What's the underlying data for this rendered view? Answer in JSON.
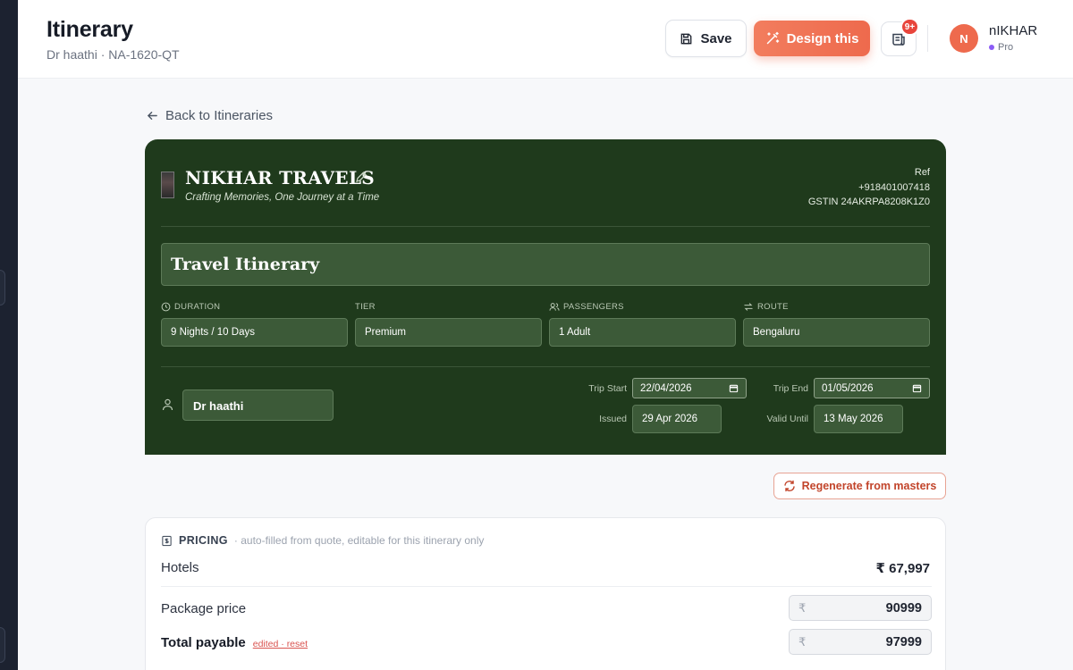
{
  "header": {
    "title": "Itinerary",
    "subtitle": "Dr haathi · NA-1620-QT",
    "save_label": "Save",
    "design_label": "Design this",
    "notif_count": "9+",
    "user": {
      "initial": "N",
      "name": "nIKHAR",
      "plan": "Pro"
    }
  },
  "nav": {
    "back_label": "Back to Itineraries"
  },
  "card": {
    "company": "NIKHAR TRAVELS",
    "tagline": "Crafting Memories, One Journey at a Time",
    "ref_label": "Ref",
    "phone": "+918401007418",
    "gstin": "GSTIN 24AKRPA8208K1Z0",
    "doc_title": "Travel Itinerary",
    "fields": [
      {
        "label": "Duration",
        "value": "9 Nights / 10 Days",
        "icon": "clock-icon"
      },
      {
        "label": "Tier",
        "value": "Premium",
        "icon": ""
      },
      {
        "label": "Passengers",
        "value": "1 Adult",
        "icon": "users-icon"
      },
      {
        "label": "Route",
        "value": "Bengaluru",
        "icon": "route-icon"
      }
    ],
    "client_name": "Dr haathi",
    "trip_start_label": "Trip Start",
    "trip_start": "22/04/2026",
    "trip_end_label": "Trip End",
    "trip_end": "01/05/2026",
    "issued_label": "Issued",
    "issued": "29 Apr 2026",
    "valid_until_label": "Valid Until",
    "valid_until": "13 May 2026"
  },
  "actions": {
    "regenerate_label": "Regenerate from masters"
  },
  "pricing": {
    "title": "PRICING",
    "note": "· auto-filled from quote, editable for this itinerary only",
    "hotels_label": "Hotels",
    "hotels_value": "₹ 67,997",
    "package_label": "Package price",
    "package_currency": "₹",
    "package_value": "90999",
    "total_label": "Total payable",
    "total_edited": "edited · reset",
    "total_currency": "₹",
    "total_value": "97999",
    "footnote": ""
  },
  "colors": {
    "accent": "#ee6a4d",
    "card_bg": "#1f3a1c",
    "field_bg": "#3c5a38"
  }
}
